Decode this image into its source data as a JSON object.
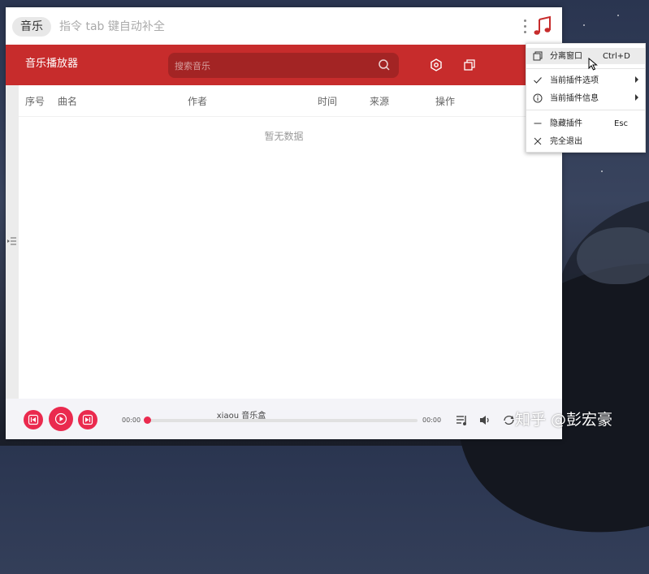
{
  "launcher": {
    "tag": "音乐",
    "placeholder": "指令 tab 键自动补全"
  },
  "player": {
    "title": "音乐播放器",
    "search_placeholder": "搜索音乐",
    "accent_color": "#c72c2c"
  },
  "table": {
    "columns": [
      "序号",
      "曲名",
      "作者",
      "时间",
      "来源",
      "操作"
    ],
    "empty_text": "暂无数据"
  },
  "footer": {
    "song": "xiaou 音乐盒",
    "current_time": "00:00",
    "total_time": "00:00",
    "progress": 0,
    "accent_color": "#ea2a4e"
  },
  "menu": {
    "items": [
      {
        "label": "分离窗口",
        "shortcut": "Ctrl+D",
        "icon": "window-icon"
      },
      {
        "label": "当前插件选项",
        "icon": "check-icon",
        "submenu": true
      },
      {
        "label": "当前插件信息",
        "icon": "info-icon",
        "submenu": true
      },
      {
        "label": "隐藏插件",
        "shortcut": "Esc",
        "icon": "minus-icon"
      },
      {
        "label": "完全退出",
        "icon": "close-icon"
      }
    ]
  },
  "watermark": "知乎 @彭宏豪"
}
